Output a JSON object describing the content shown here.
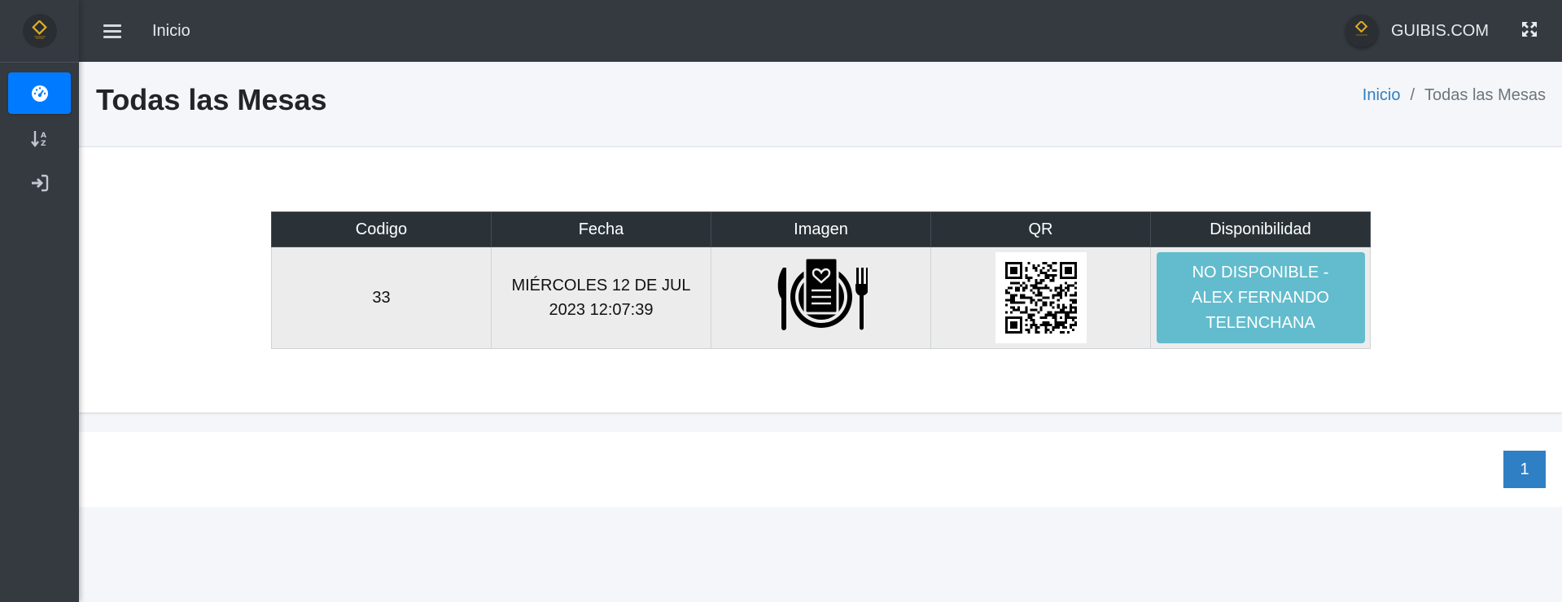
{
  "topbar": {
    "nav_link": "Inicio",
    "user_name": "GUIBIS.COM"
  },
  "sidebar": {
    "items": [
      {
        "icon": "tachometer-icon",
        "active": true
      },
      {
        "icon": "sort-alpha-down-icon",
        "active": false
      },
      {
        "icon": "sign-in-icon",
        "active": false
      }
    ]
  },
  "header": {
    "title": "Todas las Mesas",
    "breadcrumb": {
      "home": "Inicio",
      "separator": "/",
      "current": "Todas las Mesas"
    }
  },
  "table": {
    "columns": [
      "Codigo",
      "Fecha",
      "Imagen",
      "QR",
      "Disponibilidad"
    ],
    "rows": [
      {
        "codigo": "33",
        "fecha_line1": "MIÉRCOLES 12 DE JUL",
        "fecha_line2": "2023 12:07:39",
        "imagen": "restaurant-menu-icon",
        "qr": "qr-code-icon",
        "disponibilidad_lines": [
          "NO DISPONIBLE -",
          "ALEX FERNANDO",
          "TELENCHANA"
        ]
      }
    ]
  },
  "pagination": {
    "current_page": "1"
  },
  "colors": {
    "sidebar_bg": "#343a40",
    "active_nav": "#007bff",
    "table_header": "#2a3238",
    "availability_button": "#62bccd",
    "pagination_button": "#2f7fc4",
    "brand_gold": "#e0b020"
  }
}
